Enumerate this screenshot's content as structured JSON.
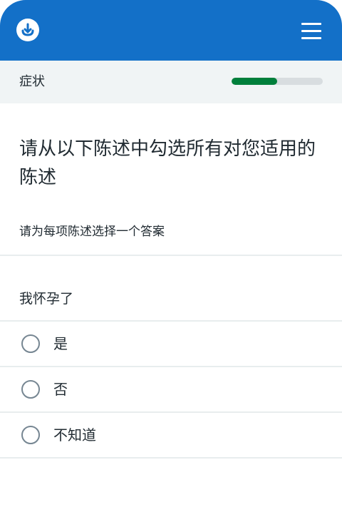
{
  "header": {
    "logo_icon": "anchor-download-icon",
    "menu_icon": "hamburger-menu-icon",
    "brand_color": "#1370c8"
  },
  "progress": {
    "section_label": "症状",
    "fraction": 0.5,
    "fill_color": "#007f3b",
    "track_color": "#d8dde0"
  },
  "question": {
    "title": "请从以下陈述中勾选所有对您适用的陈述",
    "hint": "请为每项陈述选择一个答案",
    "statement": "我怀孕了",
    "options": [
      {
        "label": "是",
        "selected": false
      },
      {
        "label": "否",
        "selected": false
      },
      {
        "label": "不知道",
        "selected": false
      }
    ]
  }
}
